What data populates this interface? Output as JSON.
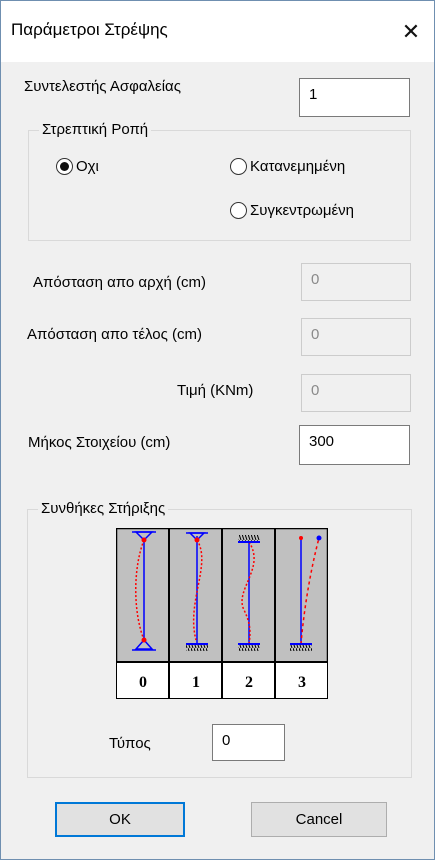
{
  "window": {
    "title": "Παράμετροι Στρέψης",
    "close_glyph": "✕"
  },
  "safety_factor": {
    "label": "Συντελεστής Ασφαλείας",
    "value": "1"
  },
  "torsional_moment": {
    "title": "Στρεπτική Ροπή",
    "options": [
      {
        "label": "Οχι",
        "checked": true
      },
      {
        "label": "Κατανεμημένη",
        "checked": false
      },
      {
        "label": "Συγκεντρωμένη",
        "checked": false
      }
    ]
  },
  "distance_start": {
    "label": "Απόσταση απο αρχή (cm)",
    "value": "0"
  },
  "distance_end": {
    "label": "Απόσταση απο τέλος (cm)",
    "value": "0"
  },
  "value_knm": {
    "label": "Τιμή (KNm)",
    "value": "0"
  },
  "element_length": {
    "label": "Μήκος Στοιχείου  (cm)",
    "value": "300"
  },
  "support_conditions": {
    "title": "Συνθήκες Στήριξης",
    "cases": [
      "0",
      "1",
      "2",
      "3"
    ],
    "type_label": "Τύπος",
    "type_value": "0"
  },
  "buttons": {
    "ok": "OK",
    "cancel": "Cancel"
  },
  "colors": {
    "member": "#0000ff",
    "deflection": "#ff0000",
    "panel": "#c0c0c0",
    "accent": "#0078d7"
  }
}
